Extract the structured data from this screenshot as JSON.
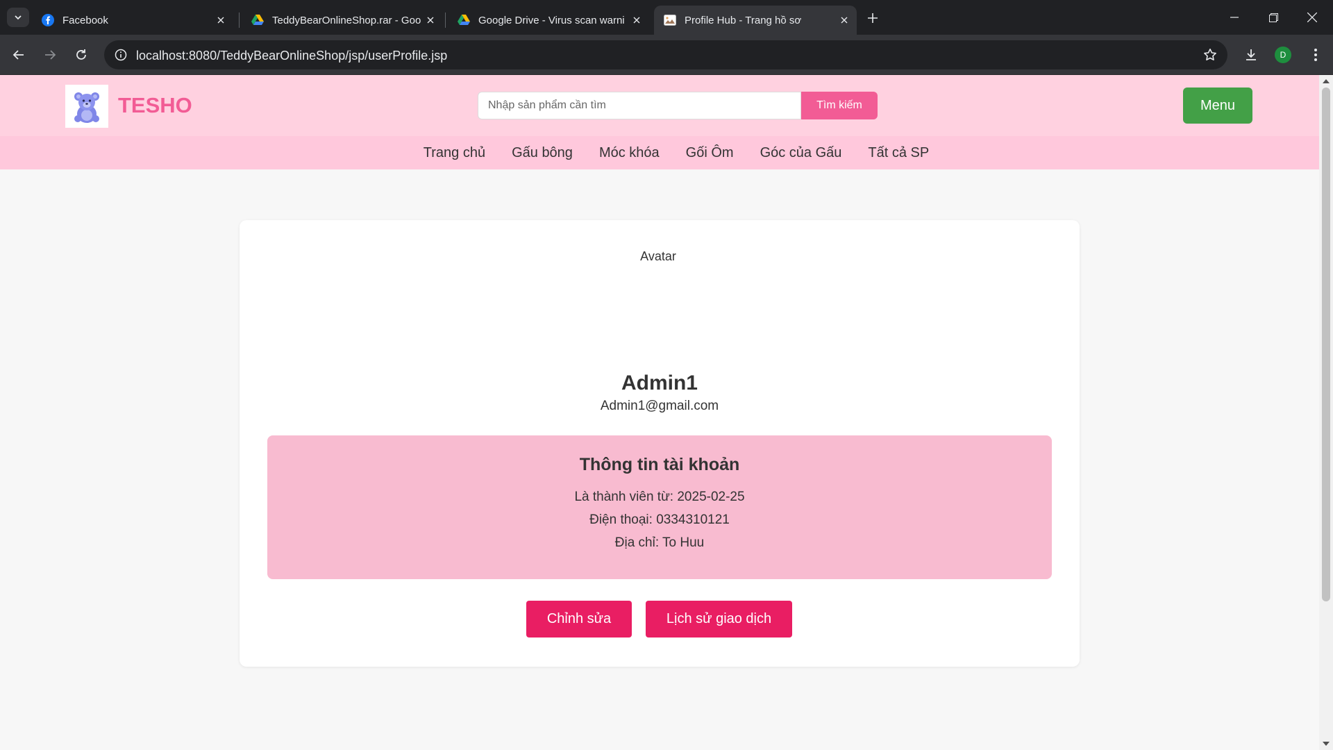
{
  "browser": {
    "tabs": [
      {
        "title": "Facebook",
        "icon": "facebook-icon"
      },
      {
        "title": "TeddyBearOnlineShop.rar - Goo",
        "icon": "google-drive-icon"
      },
      {
        "title": "Google Drive - Virus scan warni",
        "icon": "google-drive-icon"
      },
      {
        "title": "Profile Hub - Trang hồ sơ",
        "icon": "page-favicon"
      }
    ],
    "active_tab": 3,
    "url": "localhost:8080/TeddyBearOnlineShop/jsp/userProfile.jsp",
    "profile_initial": "D"
  },
  "site": {
    "brand": "TESHO",
    "search_placeholder": "Nhập sản phẩm cần tìm",
    "search_button": "Tìm kiếm",
    "menu_button": "Menu",
    "nav": [
      "Trang chủ",
      "Gấu bông",
      "Móc khóa",
      "Gối Ôm",
      "Góc của Gấu",
      "Tất cả SP"
    ]
  },
  "profile": {
    "avatar_alt": "Avatar",
    "name": "Admin1",
    "email": "Admin1@gmail.com",
    "info_title": "Thông tin tài khoản",
    "member_since": "Là thành viên từ: 2025-02-25",
    "phone": "Điện thoại: 0334310121",
    "address": "Địa chỉ: To Huu",
    "edit_button": "Chỉnh sửa",
    "history_button": "Lịch sử giao dịch"
  },
  "colors": {
    "brand_pink": "#f25c95",
    "header_bg": "#ffd1e0",
    "nav_bg": "#ffc8dc",
    "info_bg": "#f8bbd0",
    "action_pink": "#e91e63",
    "menu_green": "#43a047"
  }
}
